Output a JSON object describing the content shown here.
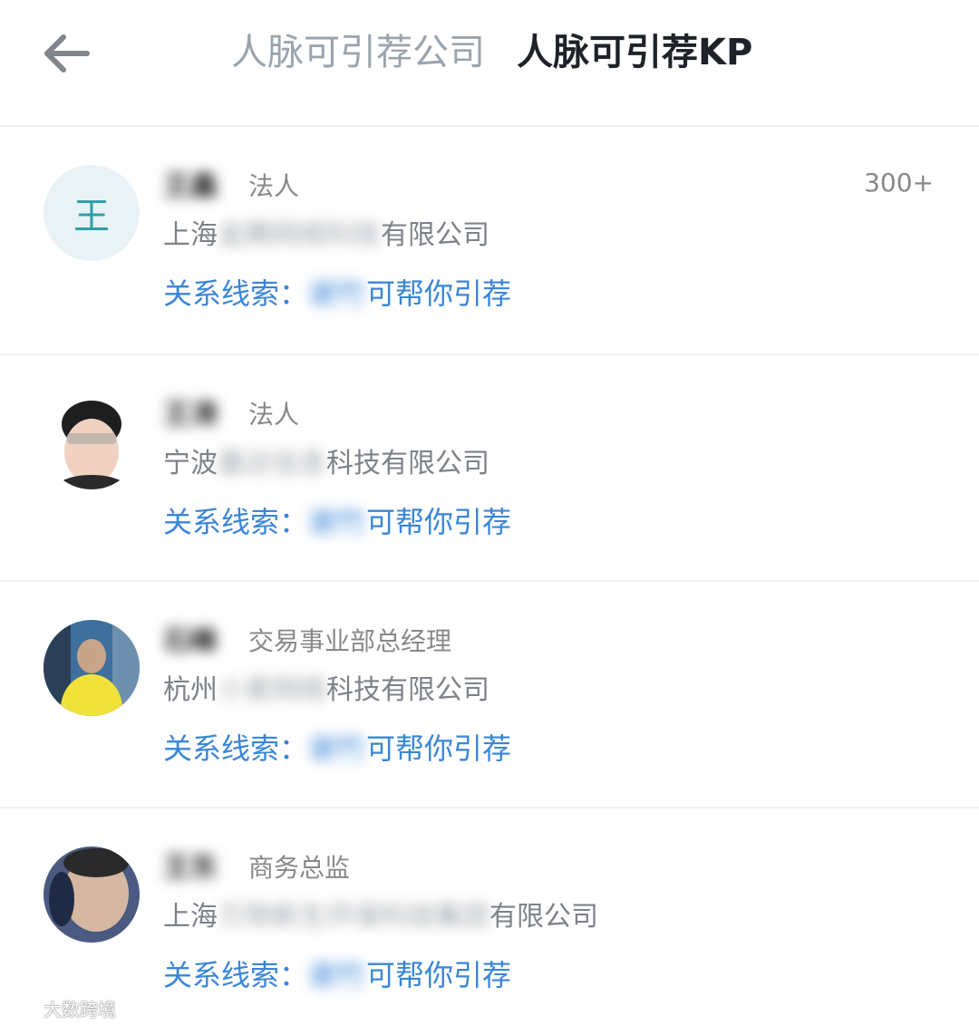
{
  "header": {
    "tabs": [
      {
        "label": "人脉可引荐公司",
        "active": false
      },
      {
        "label": "人脉可引荐KP",
        "active": true
      }
    ]
  },
  "contacts": [
    {
      "avatar_letter": "王",
      "name_blurred": "王鑫",
      "role": "法人",
      "company_prefix": "上海",
      "company_blurred": "金腾网络科技",
      "company_suffix": "有限公司",
      "clue_label": "关系线索：",
      "clue_blurred": "谢竹",
      "clue_suffix": "可帮你引荐",
      "count": "300+"
    },
    {
      "name_blurred": "王涛",
      "role": "法人",
      "company_prefix": "宁波",
      "company_blurred": "嘉达信息",
      "company_suffix": "科技有限公司",
      "clue_label": "关系线索：",
      "clue_blurred": "谢竹",
      "clue_suffix": "可帮你引荐"
    },
    {
      "name_blurred": "石峰",
      "role": "交易事业部总经理",
      "company_prefix": "杭州",
      "company_blurred": "小麦网络",
      "company_suffix": "科技有限公司",
      "clue_label": "关系线索：",
      "clue_blurred": "谢竹",
      "clue_suffix": "可帮你引荐"
    },
    {
      "name_blurred": "王东",
      "role": "商务总监",
      "company_prefix": "上海",
      "company_blurred": "万物新生环保科技集团",
      "company_suffix": "有限公司",
      "clue_label": "关系线索：",
      "clue_blurred": "谢竹",
      "clue_suffix": "可帮你引荐"
    }
  ],
  "watermark": "大数跨境",
  "colors": {
    "link_blue": "#3a86d7",
    "tab_inactive": "#9aa4ad",
    "tab_active": "#1f2329"
  }
}
